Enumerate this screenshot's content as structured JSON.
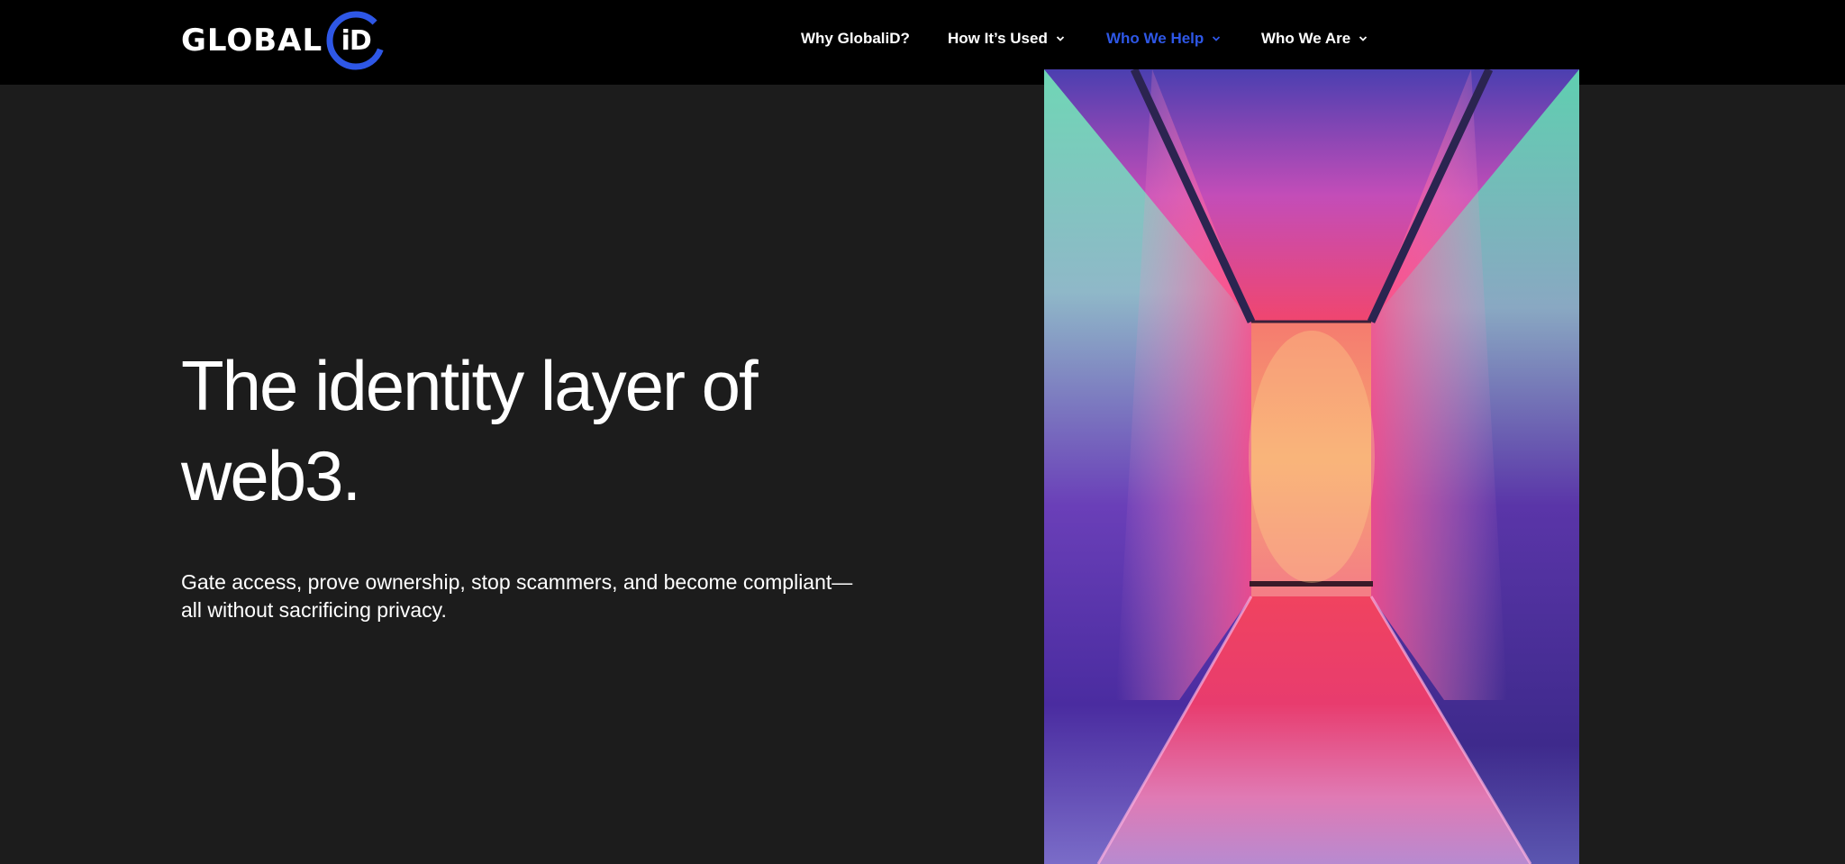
{
  "brand": {
    "wordmark": "GLOBAL",
    "mark_text": "iD",
    "accent_color": "#2e57e6"
  },
  "nav": {
    "items": [
      {
        "label": "Why GlobaliD?",
        "has_dropdown": false,
        "active": false
      },
      {
        "label": "How It’s Used",
        "has_dropdown": true,
        "active": false
      },
      {
        "label": "Who We Help",
        "has_dropdown": true,
        "active": true
      },
      {
        "label": "Who We Are",
        "has_dropdown": true,
        "active": false
      }
    ]
  },
  "hero": {
    "headline_line1": "The identity layer of",
    "headline_line2": "web3.",
    "subtext_line1": "Gate access, prove ownership, stop scammers, and become compliant—",
    "subtext_line2": "all without sacrificing privacy.",
    "image_subject": "neon-hallway-photo"
  },
  "colors": {
    "header_bg": "#000000",
    "page_bg": "#1c1c1c",
    "text": "#ffffff"
  }
}
